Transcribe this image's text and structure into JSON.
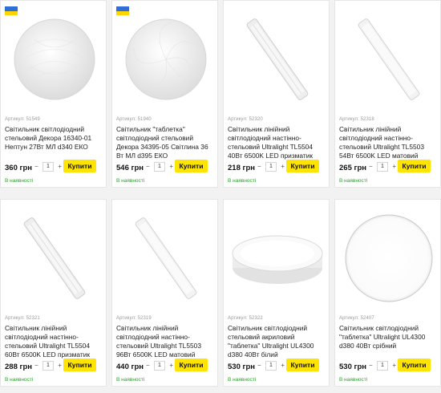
{
  "colors": {
    "buy": "#ffe400",
    "stock": "#2ca02c",
    "flag_blue": "#2f6fd6",
    "flag_yellow": "#ffd500"
  },
  "products": [
    {
      "article": "Артикул: 51549",
      "name": "Світильник світлодіодний стельовий Декора 16340-01 Нептун 27Вт МЛ d340 ЕКО",
      "price": "360 грн",
      "qty": "1",
      "minus": "−",
      "plus": "+",
      "buy": "Купити",
      "stock": "В наявності",
      "flag": true,
      "image": "round-ceiling-lamp"
    },
    {
      "article": "Артикул: 51940",
      "name": "Світильник \"таблетка\" світлодіодний стельовий Декора 34395-05 Світлина 36 Вт МЛ d395 ЕКО",
      "price": "546 грн",
      "qty": "1",
      "minus": "−",
      "plus": "+",
      "buy": "Купити",
      "stock": "В наявності",
      "flag": true,
      "image": "round-ceiling-lamp"
    },
    {
      "article": "Артикул: 52320",
      "name": "Світильник лінійний світлодіодний настінно-стельовий Ultralight TL5504 40Вт 6500K LED призматик",
      "price": "218 грн",
      "qty": "1",
      "minus": "−",
      "plus": "+",
      "buy": "Купити",
      "stock": "В наявності",
      "flag": false,
      "image": "linear-prismatic-lamp"
    },
    {
      "article": "Артикул: 52318",
      "name": "Світильник лінійний світлодіодний настінно-стельовий Ultralight TL5503 54Вт 6500K LED матовий",
      "price": "265 грн",
      "qty": "1",
      "minus": "−",
      "plus": "+",
      "buy": "Купити",
      "stock": "В наявності",
      "flag": false,
      "image": "linear-matte-lamp"
    },
    {
      "article": "Артикул: 52321",
      "name": "Світильник лінійний світлодіодний настінно-стельовий Ultralight TL5504 60Вт 6500K LED призматик",
      "price": "288 грн",
      "qty": "1",
      "minus": "−",
      "plus": "+",
      "buy": "Купити",
      "stock": "В наявності",
      "flag": false,
      "image": "linear-prismatic-lamp"
    },
    {
      "article": "Артикул: 52319",
      "name": "Світильник лінійний світлодіодний настінно-стельовий Ultralight TL5503 96Вт 6500K LED матовий",
      "price": "440 грн",
      "qty": "1",
      "minus": "−",
      "plus": "+",
      "buy": "Купити",
      "stock": "В наявності",
      "flag": false,
      "image": "linear-matte-lamp"
    },
    {
      "article": "Артикул: 52322",
      "name": "Світильник світлодіодний стельовий акриловий \"таблетка\" Ultralight UL4300 d380 40Вт білий",
      "price": "530 грн",
      "qty": "1",
      "minus": "−",
      "plus": "+",
      "buy": "Купити",
      "stock": "В наявності",
      "flag": false,
      "image": "round-tablet-lamp"
    },
    {
      "article": "Артикул: 52407",
      "name": "Світильник світлодіодний \"таблетка\" Ultralight UL4300 d380 40Вт срібний",
      "price": "530 грн",
      "qty": "1",
      "minus": "−",
      "plus": "+",
      "buy": "Купити",
      "stock": "В наявності",
      "flag": false,
      "image": "round-silver-lamp"
    }
  ]
}
